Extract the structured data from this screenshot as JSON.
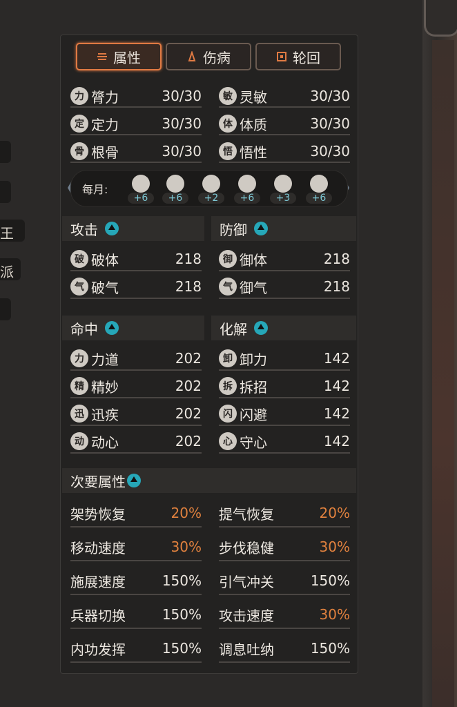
{
  "left_stubs": [
    "",
    "",
    "王",
    "派",
    ""
  ],
  "tabs": [
    {
      "label": "属性",
      "active": true,
      "icon": "layers-icon"
    },
    {
      "label": "伤病",
      "active": false,
      "icon": "fire-icon"
    },
    {
      "label": "轮回",
      "active": false,
      "icon": "cycle-icon"
    }
  ],
  "attributes": [
    {
      "label": "膂力",
      "value": "30/30",
      "icon": "arm-icon"
    },
    {
      "label": "灵敏",
      "value": "30/30",
      "icon": "boot-icon"
    },
    {
      "label": "定力",
      "value": "30/30",
      "icon": "mountain-icon"
    },
    {
      "label": "体质",
      "value": "30/30",
      "icon": "torso-icon"
    },
    {
      "label": "根骨",
      "value": "30/30",
      "icon": "bones-icon"
    },
    {
      "label": "悟性",
      "value": "30/30",
      "icon": "brush-icon"
    }
  ],
  "monthly": {
    "label": "每月:",
    "items": [
      {
        "icon": "arm-icon",
        "value": "+6"
      },
      {
        "icon": "boot-icon",
        "value": "+6"
      },
      {
        "icon": "torso-icon",
        "value": "+2"
      },
      {
        "icon": "bones-icon",
        "value": "+6"
      },
      {
        "icon": "mountain-icon",
        "value": "+3"
      },
      {
        "icon": "brush-icon",
        "value": "+6"
      }
    ]
  },
  "sections": {
    "attack": {
      "title": "攻击",
      "rows": [
        {
          "label": "破体",
          "value": "218",
          "icon": "burst-icon"
        },
        {
          "label": "破气",
          "value": "218",
          "icon": "swirl-icon"
        }
      ]
    },
    "defense": {
      "title": "防御",
      "rows": [
        {
          "label": "御体",
          "value": "218",
          "icon": "shield-hand-icon"
        },
        {
          "label": "御气",
          "value": "218",
          "icon": "aura-icon"
        }
      ]
    },
    "hit": {
      "title": "命中",
      "rows": [
        {
          "label": "力道",
          "value": "202",
          "icon": "fist-icon"
        },
        {
          "label": "精妙",
          "value": "202",
          "icon": "eye-star-icon"
        },
        {
          "label": "迅疾",
          "value": "202",
          "icon": "dash-icon"
        },
        {
          "label": "动心",
          "value": "202",
          "icon": "heart-hand-icon"
        }
      ]
    },
    "resolve": {
      "title": "化解",
      "rows": [
        {
          "label": "卸力",
          "value": "142",
          "icon": "palm-icon"
        },
        {
          "label": "拆招",
          "value": "142",
          "icon": "cross-swords-icon"
        },
        {
          "label": "闪避",
          "value": "142",
          "icon": "lightning-icon"
        },
        {
          "label": "守心",
          "value": "142",
          "icon": "heart-icon"
        }
      ]
    }
  },
  "secondary": {
    "title": "次要属性",
    "rows": [
      {
        "label": "架势恢复",
        "value": "20%",
        "highlight": true
      },
      {
        "label": "提气恢复",
        "value": "20%",
        "highlight": true
      },
      {
        "label": "移动速度",
        "value": "30%",
        "highlight": true
      },
      {
        "label": "步伐稳健",
        "value": "30%",
        "highlight": true
      },
      {
        "label": "施展速度",
        "value": "150%",
        "highlight": false
      },
      {
        "label": "引气冲关",
        "value": "150%",
        "highlight": false
      },
      {
        "label": "兵器切换",
        "value": "150%",
        "highlight": false
      },
      {
        "label": "攻击速度",
        "value": "30%",
        "highlight": true
      },
      {
        "label": "内功发挥",
        "value": "150%",
        "highlight": false
      },
      {
        "label": "调息吐纳",
        "value": "150%",
        "highlight": false
      }
    ]
  },
  "colors": {
    "accent": "#e07a43",
    "highlight": "#e0813e",
    "up_arrow": "#26a7b8",
    "monthly_value": "#7ec9d6"
  }
}
